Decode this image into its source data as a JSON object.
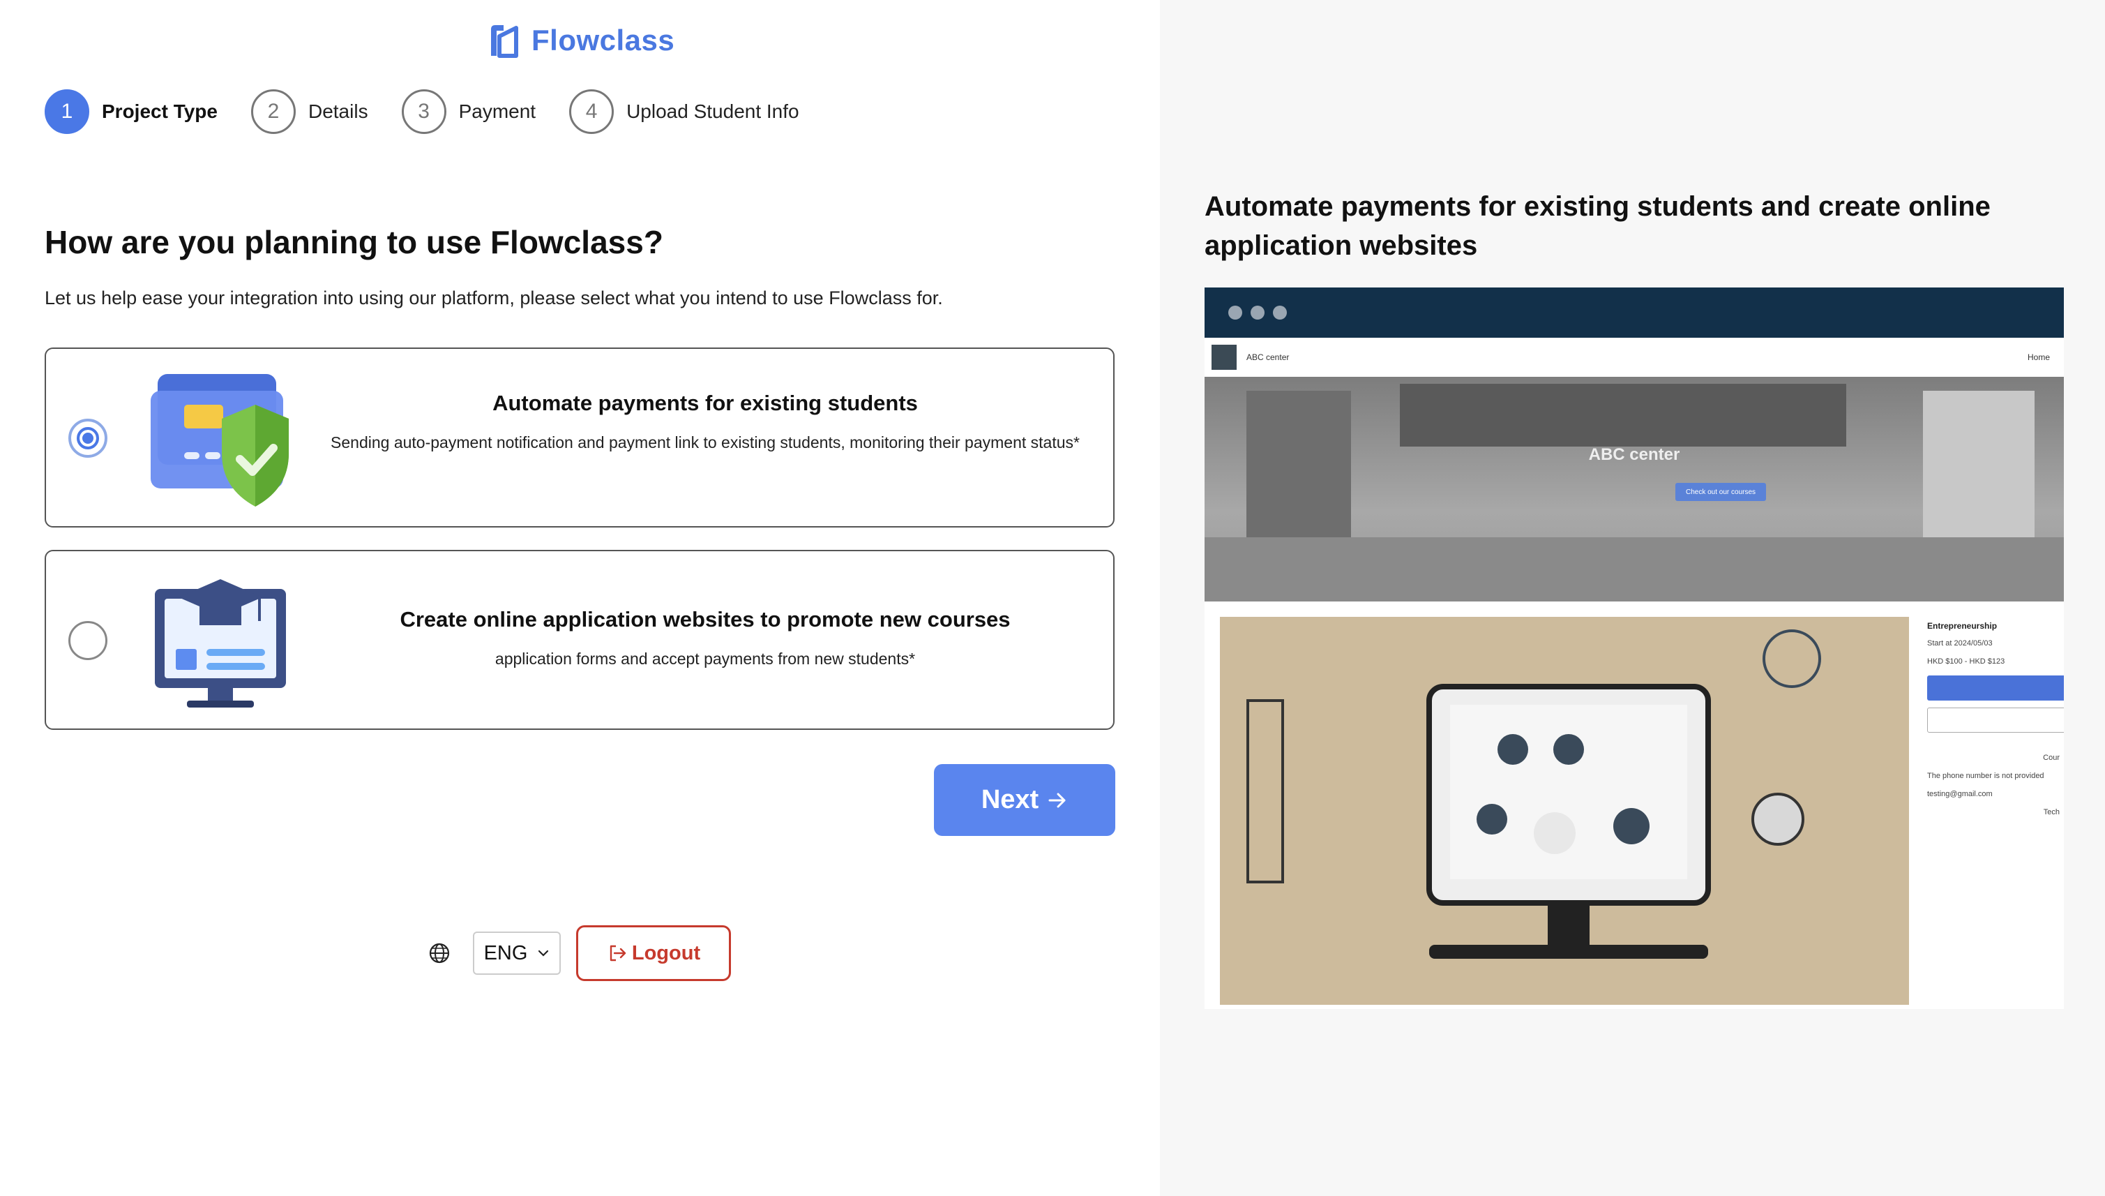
{
  "brand": {
    "name": "Flowclass",
    "color": "#4a78e0"
  },
  "stepper": [
    {
      "number": "1",
      "label": "Project Type",
      "active": true
    },
    {
      "number": "2",
      "label": "Details",
      "active": false
    },
    {
      "number": "3",
      "label": "Payment",
      "active": false
    },
    {
      "number": "4",
      "label": "Upload Student Info",
      "active": false
    }
  ],
  "main": {
    "heading": "How are you planning to use Flowclass?",
    "subtext": "Let us help ease your integration into using our platform, please select what you intend to use Flowclass for.",
    "options": [
      {
        "title": "Automate payments for existing students",
        "description": "Sending auto-payment notification and payment link to existing students, monitoring their payment status*",
        "selected": true,
        "icon": "payment-shield-icon"
      },
      {
        "title": "Create online application websites to promote new courses",
        "description": "application forms and accept payments from new students*",
        "selected": false,
        "icon": "monitor-graduation-icon"
      }
    ],
    "next_label": "Next"
  },
  "footer": {
    "language": "ENG",
    "logout_label": "Logout"
  },
  "preview": {
    "title": "Automate payments for existing students and create online application websites",
    "site": {
      "nav_brand": "ABC center",
      "nav_home": "Home",
      "hero_title": "ABC center",
      "hero_button": "Check out our courses",
      "course_title": "Entrepreneurship",
      "course_start": "Start at 2024/05/03",
      "course_price": "HKD $100 - HKD $123",
      "course_label": "Cour",
      "phone_note": "The phone number is not provided",
      "email": "testing@gmail.com",
      "tech": "Tech"
    }
  },
  "colors": {
    "accent": "#4a78e6",
    "danger": "#c63a2d",
    "browser_bar": "#12304a"
  }
}
